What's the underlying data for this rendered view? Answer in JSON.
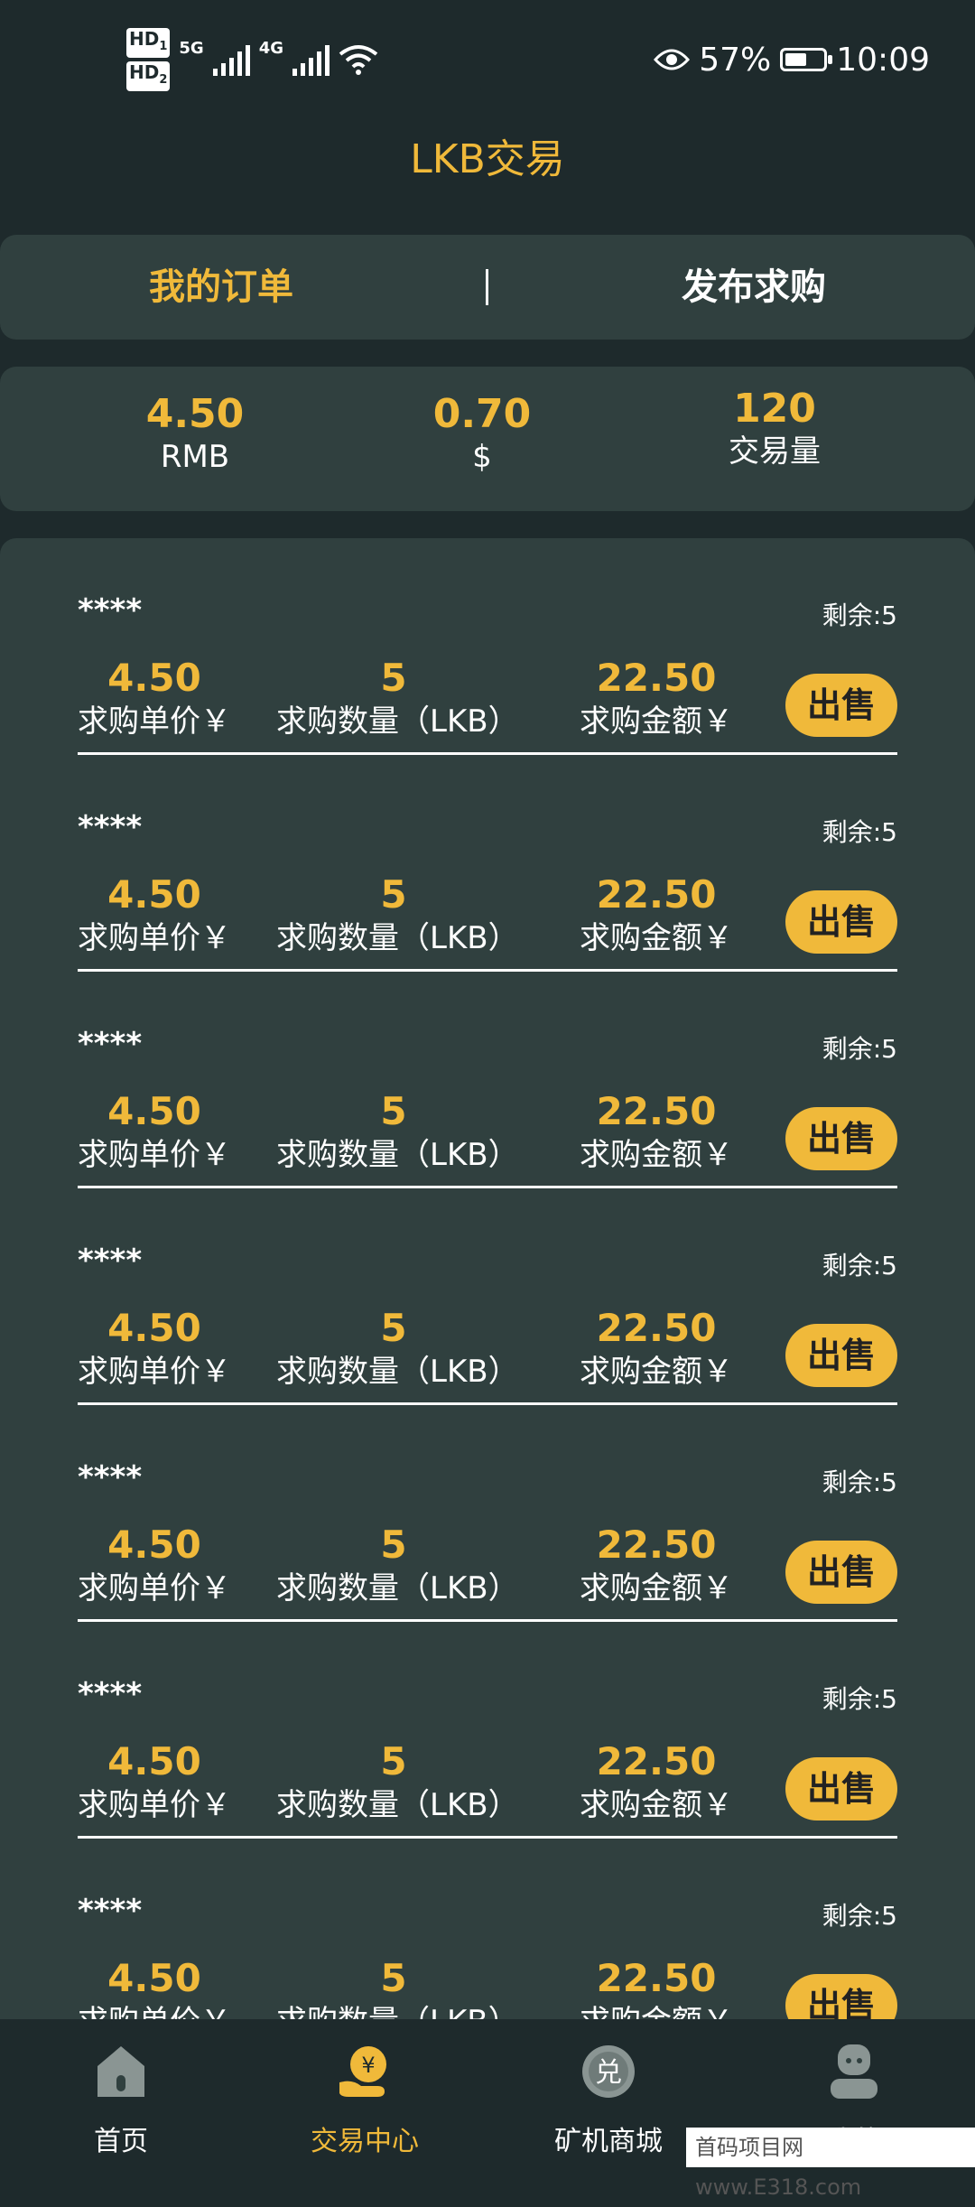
{
  "status_bar": {
    "sim1": "HD",
    "sim1_idx": "1",
    "sim2": "HD",
    "sim2_idx": "2",
    "network1": "5G",
    "network2": "4G",
    "battery_percent": "57%",
    "battery_level": 0.57,
    "time": "10:09"
  },
  "header": {
    "title": "LKB交易"
  },
  "tabs": [
    {
      "label": "我的订单",
      "active": true
    },
    {
      "label": "发布求购",
      "active": false
    }
  ],
  "tab_separator": "|",
  "stats": [
    {
      "value": "4.50",
      "label": "RMB"
    },
    {
      "value": "0.70",
      "label": "$"
    },
    {
      "value": "120",
      "label": "交易量"
    }
  ],
  "orders": [
    {
      "user": "****",
      "remaining": "剩余:5",
      "price": "4.50",
      "price_label": "求购单价￥",
      "qty": "5",
      "qty_label": "求购数量（LKB）",
      "amount": "22.50",
      "amount_label": "求购金额￥",
      "button": "出售"
    },
    {
      "user": "****",
      "remaining": "剩余:5",
      "price": "4.50",
      "price_label": "求购单价￥",
      "qty": "5",
      "qty_label": "求购数量（LKB）",
      "amount": "22.50",
      "amount_label": "求购金额￥",
      "button": "出售"
    },
    {
      "user": "****",
      "remaining": "剩余:5",
      "price": "4.50",
      "price_label": "求购单价￥",
      "qty": "5",
      "qty_label": "求购数量（LKB）",
      "amount": "22.50",
      "amount_label": "求购金额￥",
      "button": "出售"
    },
    {
      "user": "****",
      "remaining": "剩余:5",
      "price": "4.50",
      "price_label": "求购单价￥",
      "qty": "5",
      "qty_label": "求购数量（LKB）",
      "amount": "22.50",
      "amount_label": "求购金额￥",
      "button": "出售"
    },
    {
      "user": "****",
      "remaining": "剩余:5",
      "price": "4.50",
      "price_label": "求购单价￥",
      "qty": "5",
      "qty_label": "求购数量（LKB）",
      "amount": "22.50",
      "amount_label": "求购金额￥",
      "button": "出售"
    },
    {
      "user": "****",
      "remaining": "剩余:5",
      "price": "4.50",
      "price_label": "求购单价￥",
      "qty": "5",
      "qty_label": "求购数量（LKB）",
      "amount": "22.50",
      "amount_label": "求购金额￥",
      "button": "出售"
    },
    {
      "user": "****",
      "remaining": "剩余:5",
      "price": "4.50",
      "price_label": "求购单价￥",
      "qty": "5",
      "qty_label": "求购数量（LKB）",
      "amount": "22.50",
      "amount_label": "求购金额￥",
      "button": "出售"
    }
  ],
  "bottom_nav": [
    {
      "label": "首页",
      "icon": "home-icon",
      "active": false
    },
    {
      "label": "交易中心",
      "icon": "trade-center-icon",
      "active": true
    },
    {
      "label": "矿机商城",
      "icon": "exchange-icon",
      "active": false
    },
    {
      "label": "我的",
      "icon": "profile-icon",
      "active": false
    }
  ],
  "watermark": "首码项目网 www.E318.com",
  "colors": {
    "background": "#1e2a2c",
    "panel": "#30403f",
    "accent": "#f0b93a",
    "text": "#ffffff"
  }
}
